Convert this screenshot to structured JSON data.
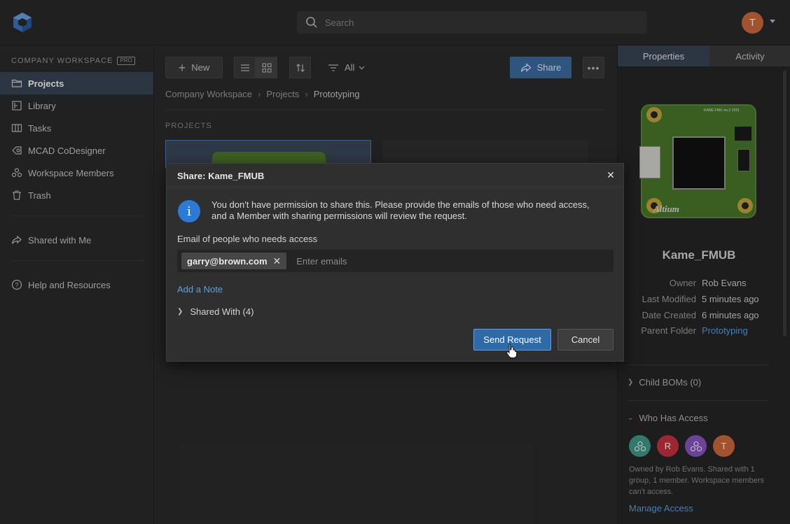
{
  "topbar": {
    "search_placeholder": "Search",
    "avatar_initial": "T"
  },
  "sidebar": {
    "workspace_title": "COMPANY WORKSPACE",
    "badge": "PRO",
    "items": [
      {
        "label": "Projects",
        "icon": "folder-icon"
      },
      {
        "label": "Library",
        "icon": "library-icon"
      },
      {
        "label": "Tasks",
        "icon": "tasks-icon"
      },
      {
        "label": "MCAD CoDesigner",
        "icon": "mcad-icon"
      },
      {
        "label": "Workspace Members",
        "icon": "members-icon"
      },
      {
        "label": "Trash",
        "icon": "trash-icon"
      }
    ],
    "shared": {
      "label": "Shared with Me",
      "icon": "share-icon"
    },
    "help": {
      "label": "Help and Resources",
      "icon": "help-icon"
    }
  },
  "toolbar": {
    "new_label": "New",
    "filter_label": "All",
    "share_label": "Share",
    "more_label": "•••"
  },
  "breadcrumb": [
    "Company Workspace",
    "Projects",
    "Prototyping"
  ],
  "main": {
    "section_label": "PROJECTS"
  },
  "panel": {
    "tabs": [
      "Properties",
      "Activity"
    ],
    "project_name": "Kame_FMUB",
    "pcb_label": "KAME FMU rev.2 2021",
    "pcb_brand": "Altium",
    "meta": [
      {
        "key": "Owner",
        "value": "Rob Evans"
      },
      {
        "key": "Last Modified",
        "value": "5 minutes ago"
      },
      {
        "key": "Date Created",
        "value": "6 minutes ago"
      },
      {
        "key": "Parent Folder",
        "value": "Prototyping"
      }
    ],
    "child_boms": "Child BOMs (0)",
    "who_has_access": "Who Has Access",
    "avatars": [
      {
        "initial": "",
        "color": "#3f9a8c"
      },
      {
        "initial": "R",
        "color": "#c9333f"
      },
      {
        "initial": "",
        "color": "#8b55c6"
      },
      {
        "initial": "T",
        "color": "#d06b3c"
      }
    ],
    "access_text": "Owned by Rob Evans. Shared with 1 group, 1 member. Workspace members can't access.",
    "manage_access": "Manage Access"
  },
  "dialog": {
    "title": "Share: Kame_FMUB",
    "close": "✕",
    "info_symbol": "i",
    "info_text": "You don't have permission to share this. Please provide the emails of those who need access, and a Member with sharing permissions will review the request.",
    "email_label": "Email of people who needs access",
    "email_chip": "garry@brown.com",
    "chip_remove": "✕",
    "email_placeholder": "Enter emails",
    "add_note": "Add a Note",
    "shared_with": "Shared With (4)",
    "send_label": "Send Request",
    "cancel_label": "Cancel"
  },
  "colors": {
    "accent": "#2e69a8",
    "link": "#5aa0de",
    "active_nav": "#384655"
  }
}
